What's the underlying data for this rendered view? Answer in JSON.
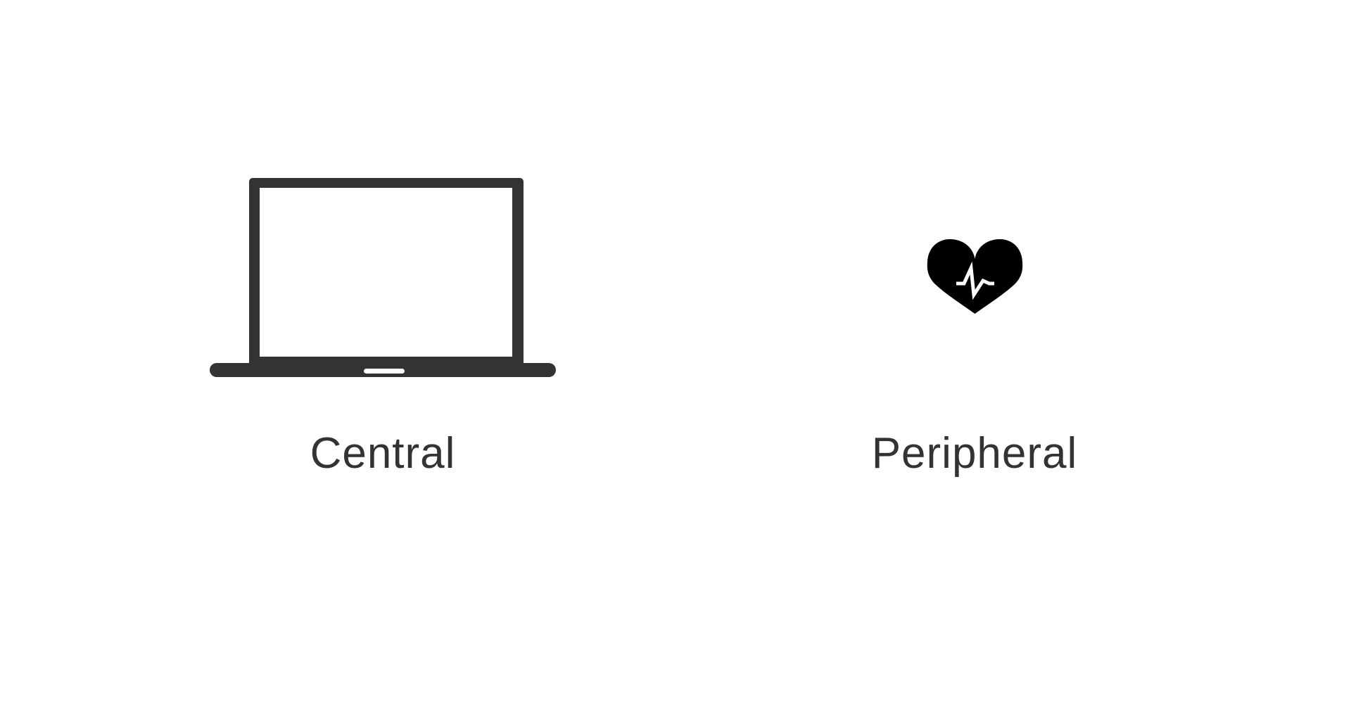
{
  "diagram": {
    "nodes": [
      {
        "id": "central",
        "label": "Central",
        "icon": "laptop-icon"
      },
      {
        "id": "peripheral",
        "label": "Peripheral",
        "icon": "heart-rate-icon"
      }
    ]
  },
  "colors": {
    "background": "#ffffff",
    "laptop": "#333333",
    "heart": "#000000",
    "label": "#333333"
  }
}
